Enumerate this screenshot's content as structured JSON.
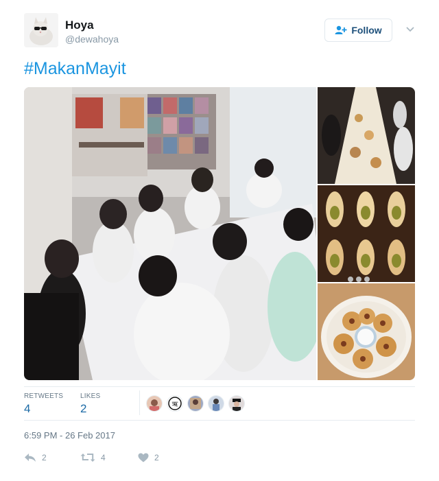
{
  "header": {
    "name": "Hoya",
    "handle": "@dewahoya",
    "follow_label": "Follow"
  },
  "tweet": {
    "text": "#MakanMayit",
    "timestamp": "6:59 PM - 26 Feb 2017"
  },
  "stats": {
    "retweets_label": "RETWEETS",
    "retweets_count": "4",
    "likes_label": "LIKES",
    "likes_count": "2"
  },
  "actions": {
    "reply_count": "2",
    "retweet_count": "4",
    "like_count": "2"
  },
  "icons": {
    "follow": "add-user-icon",
    "menu": "chevron-down-icon",
    "reply": "reply-icon",
    "retweet": "retweet-icon",
    "like": "heart-icon"
  },
  "colors": {
    "hashtag": "#1b95e0",
    "follow_text": "#1c4f7a",
    "stat_value": "#1b6aa5",
    "muted": "#657786"
  }
}
